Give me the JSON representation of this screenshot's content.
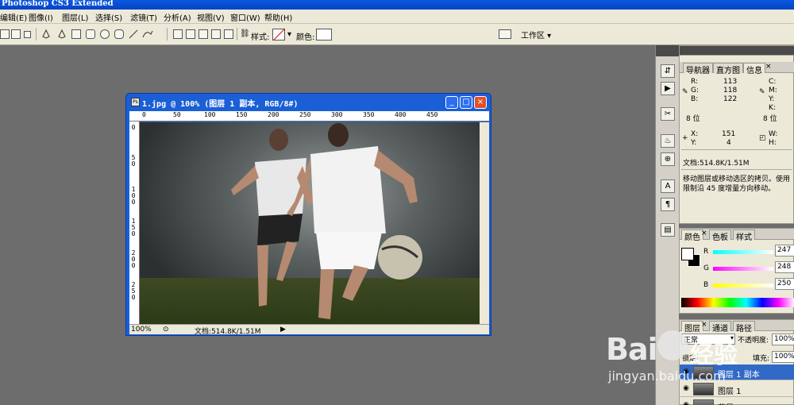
{
  "app": {
    "title": "Photoshop CS3 Extended"
  },
  "menu": [
    "编辑(E)",
    "图像(I)",
    "图层(L)",
    "选择(S)",
    "滤镜(T)",
    "分析(A)",
    "视图(V)",
    "窗口(W)",
    "帮助(H)"
  ],
  "options": {
    "style_label": "样式:",
    "color_label": "颜色:",
    "workspace_label": "工作区 ▾"
  },
  "document": {
    "title": "1.jpg @ 100% (图层 1 副本, RGB/8#)",
    "ruler_top": [
      "0",
      "50",
      "100",
      "150",
      "200",
      "250",
      "300",
      "350",
      "400",
      "450"
    ],
    "ruler_left": [
      "0",
      "5\n0",
      "1\n0\n0",
      "1\n5\n0",
      "2\n0\n0",
      "2\n5\n0"
    ],
    "zoom": "100%",
    "doc_size": "文档:514.8K/1.51M"
  },
  "info_panel": {
    "tabs": [
      "导航器",
      "直方图",
      "信息"
    ],
    "rgb": {
      "r_label": "R:",
      "r": "113",
      "g_label": "G:",
      "g": "118",
      "b_label": "B:",
      "b": "122"
    },
    "cmyk_labels": [
      "C:",
      "M:",
      "Y:",
      "K:"
    ],
    "bits_left": "8 位",
    "bits_right": "8 位",
    "xy": {
      "x_label": "X:",
      "x": "151",
      "y_label": "Y:",
      "y": "4"
    },
    "wh_labels": [
      "W:",
      "H:"
    ],
    "doc_size": "文档:514.8K/1.51M",
    "hint": "移动图层或移动选区的拷贝。使用限制沿 45 度增量方向移动。"
  },
  "color_panel": {
    "tabs": [
      "颜色",
      "色板",
      "样式"
    ],
    "r_label": "R",
    "r": "247",
    "g_label": "G",
    "g": "248",
    "b_label": "B",
    "b": "250"
  },
  "layers_panel": {
    "tabs": [
      "图层",
      "通道",
      "路径"
    ],
    "mode": "正常",
    "opacity_label": "不透明度:",
    "opacity": "100%",
    "lock_label": "锁定:",
    "fill_label": "填充:",
    "fill": "100%",
    "layers": [
      "图层 1 副本",
      "图层 1",
      "背景"
    ]
  },
  "watermark": {
    "logo": "Bai",
    "logo_cn": "经验",
    "url": "jingyan.baidu.com"
  }
}
